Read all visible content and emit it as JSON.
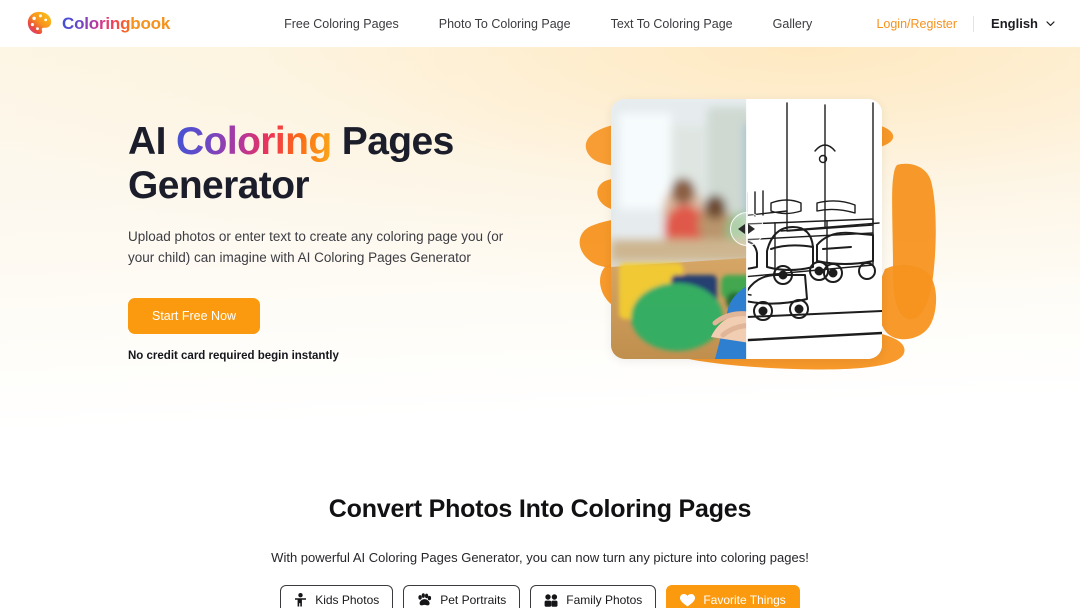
{
  "header": {
    "logo": {
      "icon": "palette-icon",
      "text_a": "Coloring",
      "text_b": "book"
    },
    "nav": [
      {
        "label": "Free Coloring Pages"
      },
      {
        "label": "Photo To Coloring Page"
      },
      {
        "label": "Text To Coloring Page"
      },
      {
        "label": "Gallery"
      }
    ],
    "login_label": "Login/Register",
    "language": {
      "label": "English",
      "icon": "chevron-down-icon"
    },
    "accent_color": "#f5921e"
  },
  "hero": {
    "heading_part1": "AI ",
    "heading_gradient": "Coloring",
    "heading_part2": " Pages Generator",
    "subtitle": "Upload photos or enter text to create any coloring page you (or your child) can imagine with AI Coloring Pages Generator",
    "cta_label": "Start Free Now",
    "cta_color": "#fb9a0e",
    "note": "No credit card required begin instantly",
    "comparison": {
      "before_alt": "Child playing with toy cars photo",
      "after_alt": "Line-art coloring page of toy cars",
      "handle_icon": "compare-slider-handle",
      "handle_position_percent": 50
    }
  },
  "convert": {
    "title": "Convert Photos Into Coloring Pages",
    "subtitle": "With powerful AI Coloring Pages Generator, you can now turn any picture into coloring pages!",
    "chips": [
      {
        "label": "Kids Photos",
        "icon": "child-icon",
        "active": false
      },
      {
        "label": "Pet Portraits",
        "icon": "paw-icon",
        "active": false
      },
      {
        "label": "Family Photos",
        "icon": "people-icon",
        "active": true
      },
      {
        "label": "Favorite Things",
        "icon": "heart-icon",
        "active": true
      }
    ]
  }
}
